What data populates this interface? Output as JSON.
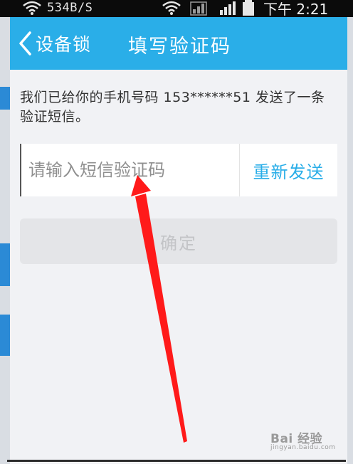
{
  "status_bar": {
    "net_speed": "534B/S",
    "clock": "下午 2:21"
  },
  "nav": {
    "back_label": "设备锁",
    "title": "填写验证码"
  },
  "info": {
    "message": "我们已给你的手机号码 153******51 发送了一条验证短信。"
  },
  "code_input": {
    "placeholder": "请输入短信验证码",
    "value": ""
  },
  "resend_label": "重新发送",
  "confirm_label": "确定",
  "watermark": {
    "main": "Bai 经验",
    "sub": "jingyan.baidu.com"
  },
  "colors": {
    "accent": "#2aaee8",
    "annotation_arrow": "#ff1a1a"
  }
}
